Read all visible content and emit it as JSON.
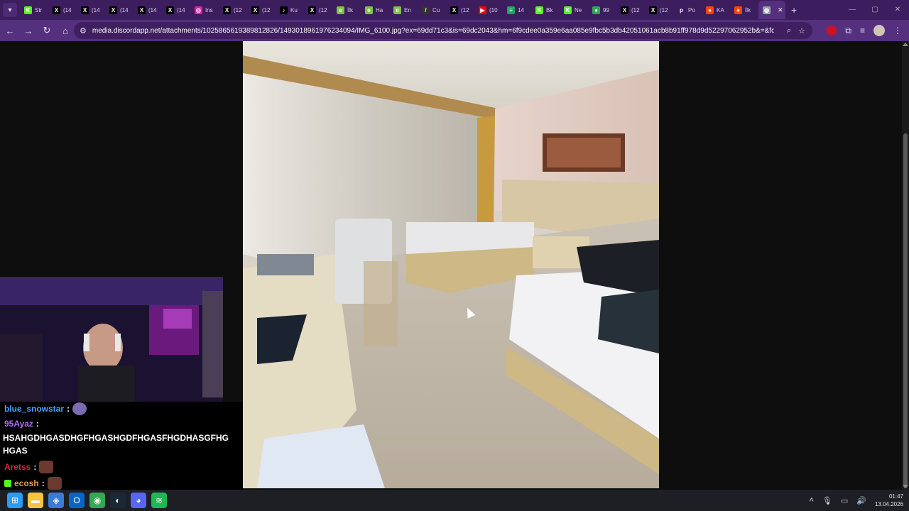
{
  "browser": {
    "tabs": [
      {
        "label": "Str",
        "icon": "kick-icon",
        "color": "#53fc18"
      },
      {
        "label": "(14",
        "icon": "x-icon",
        "color": "#000000"
      },
      {
        "label": "(14",
        "icon": "x-icon",
        "color": "#000000"
      },
      {
        "label": "(14",
        "icon": "x-icon",
        "color": "#000000"
      },
      {
        "label": "(14",
        "icon": "x-icon",
        "color": "#000000"
      },
      {
        "label": "(14",
        "icon": "x-icon",
        "color": "#000000"
      },
      {
        "label": "Ins",
        "icon": "instagram-icon",
        "color": "#d6249f"
      },
      {
        "label": "(12",
        "icon": "x-icon",
        "color": "#000000"
      },
      {
        "label": "(12",
        "icon": "x-icon",
        "color": "#000000"
      },
      {
        "label": "Ku",
        "icon": "tiktok-icon",
        "color": "#000000"
      },
      {
        "label": "(12",
        "icon": "x-icon",
        "color": "#000000"
      },
      {
        "label": "İlk",
        "icon": "eksi-icon",
        "color": "#81c14b"
      },
      {
        "label": "Ha",
        "icon": "eksi-icon",
        "color": "#81c14b"
      },
      {
        "label": "En",
        "icon": "eksi-icon",
        "color": "#81c14b"
      },
      {
        "label": "Cu",
        "icon": "slash-icon",
        "color": "#333333"
      },
      {
        "label": "(12",
        "icon": "x-icon",
        "color": "#000000"
      },
      {
        "label": "(10",
        "icon": "youtube-icon",
        "color": "#ff0000"
      },
      {
        "label": "14",
        "icon": "sheet-icon",
        "color": "#1fa463"
      },
      {
        "label": "Bk",
        "icon": "kick-icon",
        "color": "#53fc18"
      },
      {
        "label": "Ne",
        "icon": "kick-icon",
        "color": "#53fc18"
      },
      {
        "label": "99",
        "icon": "chrome-icon",
        "color": "#34a853"
      },
      {
        "label": "(12",
        "icon": "x-icon",
        "color": "#000000"
      },
      {
        "label": "(12",
        "icon": "x-icon",
        "color": "#000000"
      },
      {
        "label": "Po",
        "icon": "po-icon",
        "color": "#3c1d5e"
      },
      {
        "label": "KA",
        "icon": "reddit-icon",
        "color": "#ff4500"
      },
      {
        "label": "İlk",
        "icon": "reddit-icon",
        "color": "#ff4500"
      },
      {
        "label": "",
        "icon": "globe-icon",
        "color": "#9aa0a6",
        "active": true
      }
    ],
    "url": "media.discordapp.net/attachments/1025865619389812826/1493018961976234094/IMG_6100.jpg?ex=69dd71c3&is=69dc2043&hm=6f9cdee0a359e6aa085e9fbc5b3db42051061acb8b91ff978d9d52297062952b&=&format=webp&..."
  },
  "chat": {
    "messages": [
      {
        "user": "blue_snowstar",
        "user_color": "#4aa3ff",
        "sep": ":",
        "text": ""
      },
      {
        "user": "95Ayaz",
        "user_color": "#b36bff",
        "sep": ":",
        "text": "HSAHGDHGASDHGFHGASHGDFHGASFHGDHASGFHGHGAS"
      },
      {
        "user": "Aretss",
        "user_color": "#e0213b",
        "sep": ":",
        "text": ""
      },
      {
        "user": "ecosh",
        "user_color": "#e6a03b",
        "sep": ":",
        "text": ""
      }
    ]
  },
  "taskbar": {
    "apps": [
      {
        "name": "windows-start-icon",
        "color": "#2b9bf4"
      },
      {
        "name": "file-explorer-icon",
        "color": "#f5c542"
      },
      {
        "name": "store-icon",
        "color": "#3a7bd5"
      },
      {
        "name": "outlook-icon",
        "color": "#0a64c8"
      },
      {
        "name": "chrome-icon",
        "color": "#34a853"
      },
      {
        "name": "steam-icon",
        "color": "#1b2838"
      },
      {
        "name": "discord-icon",
        "color": "#5865f2"
      },
      {
        "name": "spotify-icon",
        "color": "#1db954"
      }
    ],
    "time": "01:47",
    "date": "13.04.2026"
  }
}
